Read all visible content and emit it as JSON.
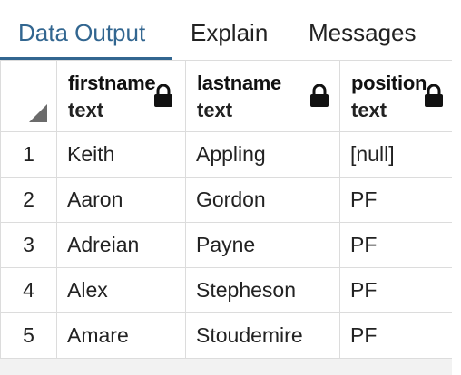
{
  "tabs": [
    {
      "label": "Data Output",
      "active": true
    },
    {
      "label": "Explain",
      "active": false
    },
    {
      "label": "Messages",
      "active": false
    }
  ],
  "columns": [
    {
      "name": "firstname",
      "type": "text",
      "icon": "lock-icon"
    },
    {
      "name": "lastname",
      "type": "text",
      "icon": "lock-icon"
    },
    {
      "name": "position",
      "type": "text",
      "icon": "lock-icon"
    }
  ],
  "rows": [
    {
      "num": "1",
      "firstname": "Keith",
      "lastname": "Appling",
      "position": "[null]"
    },
    {
      "num": "2",
      "firstname": "Aaron",
      "lastname": "Gordon",
      "position": "PF"
    },
    {
      "num": "3",
      "firstname": "Adreian",
      "lastname": "Payne",
      "position": "PF"
    },
    {
      "num": "4",
      "firstname": "Alex",
      "lastname": "Stepheson",
      "position": "PF"
    },
    {
      "num": "5",
      "firstname": "Amare",
      "lastname": "Stoudemire",
      "position": "PF"
    }
  ],
  "colors": {
    "accent": "#326690",
    "null_text": "#8a8f99",
    "grid_border": "#dcdcdc"
  }
}
